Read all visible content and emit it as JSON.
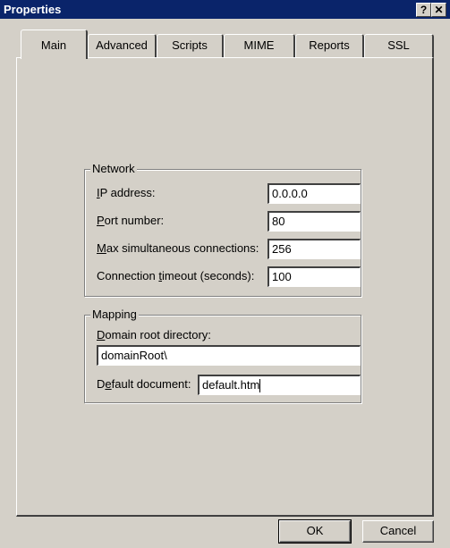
{
  "window": {
    "title": "Properties",
    "help_glyph": "?",
    "close_glyph": "✕"
  },
  "tabs": [
    {
      "label": "Main"
    },
    {
      "label": "Advanced"
    },
    {
      "label": "Scripts"
    },
    {
      "label": "MIME"
    },
    {
      "label": "Reports"
    },
    {
      "label": "SSL"
    }
  ],
  "network": {
    "title": "Network",
    "ip": {
      "u": "I",
      "rest": "P address:",
      "value": "0.0.0.0"
    },
    "port": {
      "u": "P",
      "rest": "ort number:",
      "value": "80"
    },
    "max": {
      "u": "M",
      "rest": "ax simultaneous connections:",
      "value": "256"
    },
    "timeout": {
      "pre": "Connection ",
      "u": "t",
      "rest": "imeout (seconds):",
      "value": "100"
    }
  },
  "mapping": {
    "title": "Mapping",
    "root": {
      "u": "D",
      "rest": "omain root directory:",
      "value": "domainRoot\\"
    },
    "doc": {
      "pre": "D",
      "u": "e",
      "rest": "fault document:",
      "value": "default.htm"
    }
  },
  "buttons": {
    "ok": "OK",
    "cancel": "Cancel"
  }
}
